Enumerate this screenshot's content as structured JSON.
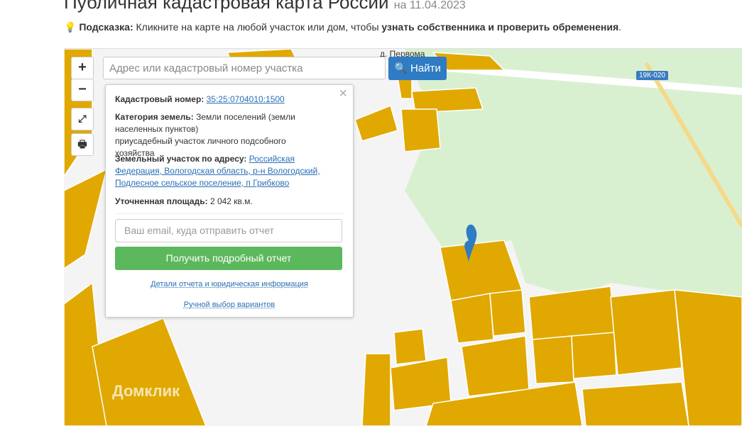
{
  "header": {
    "title": "Публичная кадастровая карта России",
    "date": "на 11.04.2023"
  },
  "hint": {
    "label": "Подсказка:",
    "text": "Кликните на карте на любой участок или дом, чтобы",
    "bold": "узнать собственника и проверить обременения",
    "end": "."
  },
  "map": {
    "zoom_in": "+",
    "zoom_out": "−",
    "search_placeholder": "Адрес или кадастровый номер участка",
    "find_label": "Найти",
    "village_label": "д. Первома",
    "road_label": "19К-020",
    "watermark": "Домклик",
    "colors": {
      "parcel": "#e0a800",
      "forest": "#d9f0d0",
      "accent": "#2f7bc4",
      "button": "#5cb85c"
    }
  },
  "popup": {
    "cad_label": "Кадастровый номер:",
    "cad_value": "35:25:0704010:1500",
    "cat_label": "Категория земель:",
    "cat_value": "Земли поселений (земли населенных пунктов)",
    "cat_use": "приусадебный участок личного подсобного хозяйства",
    "addr_label": "Земельный участок по адресу:",
    "addr_value": "Российская Федерация, Вологодская область, р-н Вологодский, Подлесное сельское поселение, п Грибково",
    "area_label": "Уточненная площадь:",
    "area_value": "2 042 кв.м.",
    "email_placeholder": "Ваш email, куда отправить отчет",
    "get_report": "Получить подробный отчет",
    "details_link": "Детали отчета и юридическая информация",
    "manual_link": "Ручной выбор вариантов",
    "close": "×"
  }
}
